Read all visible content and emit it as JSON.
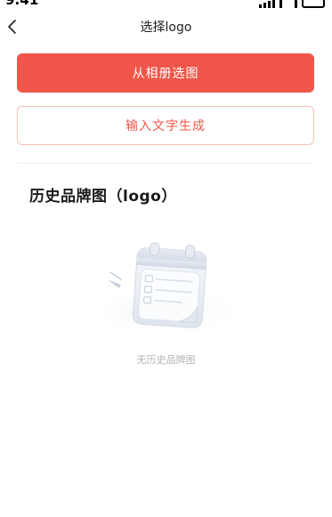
{
  "status_bar": {
    "time": "9:41"
  },
  "nav": {
    "title": "选择logo",
    "back_icon": "chevron-left-icon"
  },
  "actions": {
    "pick_from_album": "从相册选图",
    "generate_from_text": "输入文字生成"
  },
  "history": {
    "title": "历史品牌图（logo）",
    "empty_text": "无历史品牌图",
    "empty_icon": "empty-calendar-icon"
  },
  "colors": {
    "accent": "#f0564a",
    "accent_border": "#f6c3bd",
    "muted_text": "#b3b3b3"
  }
}
